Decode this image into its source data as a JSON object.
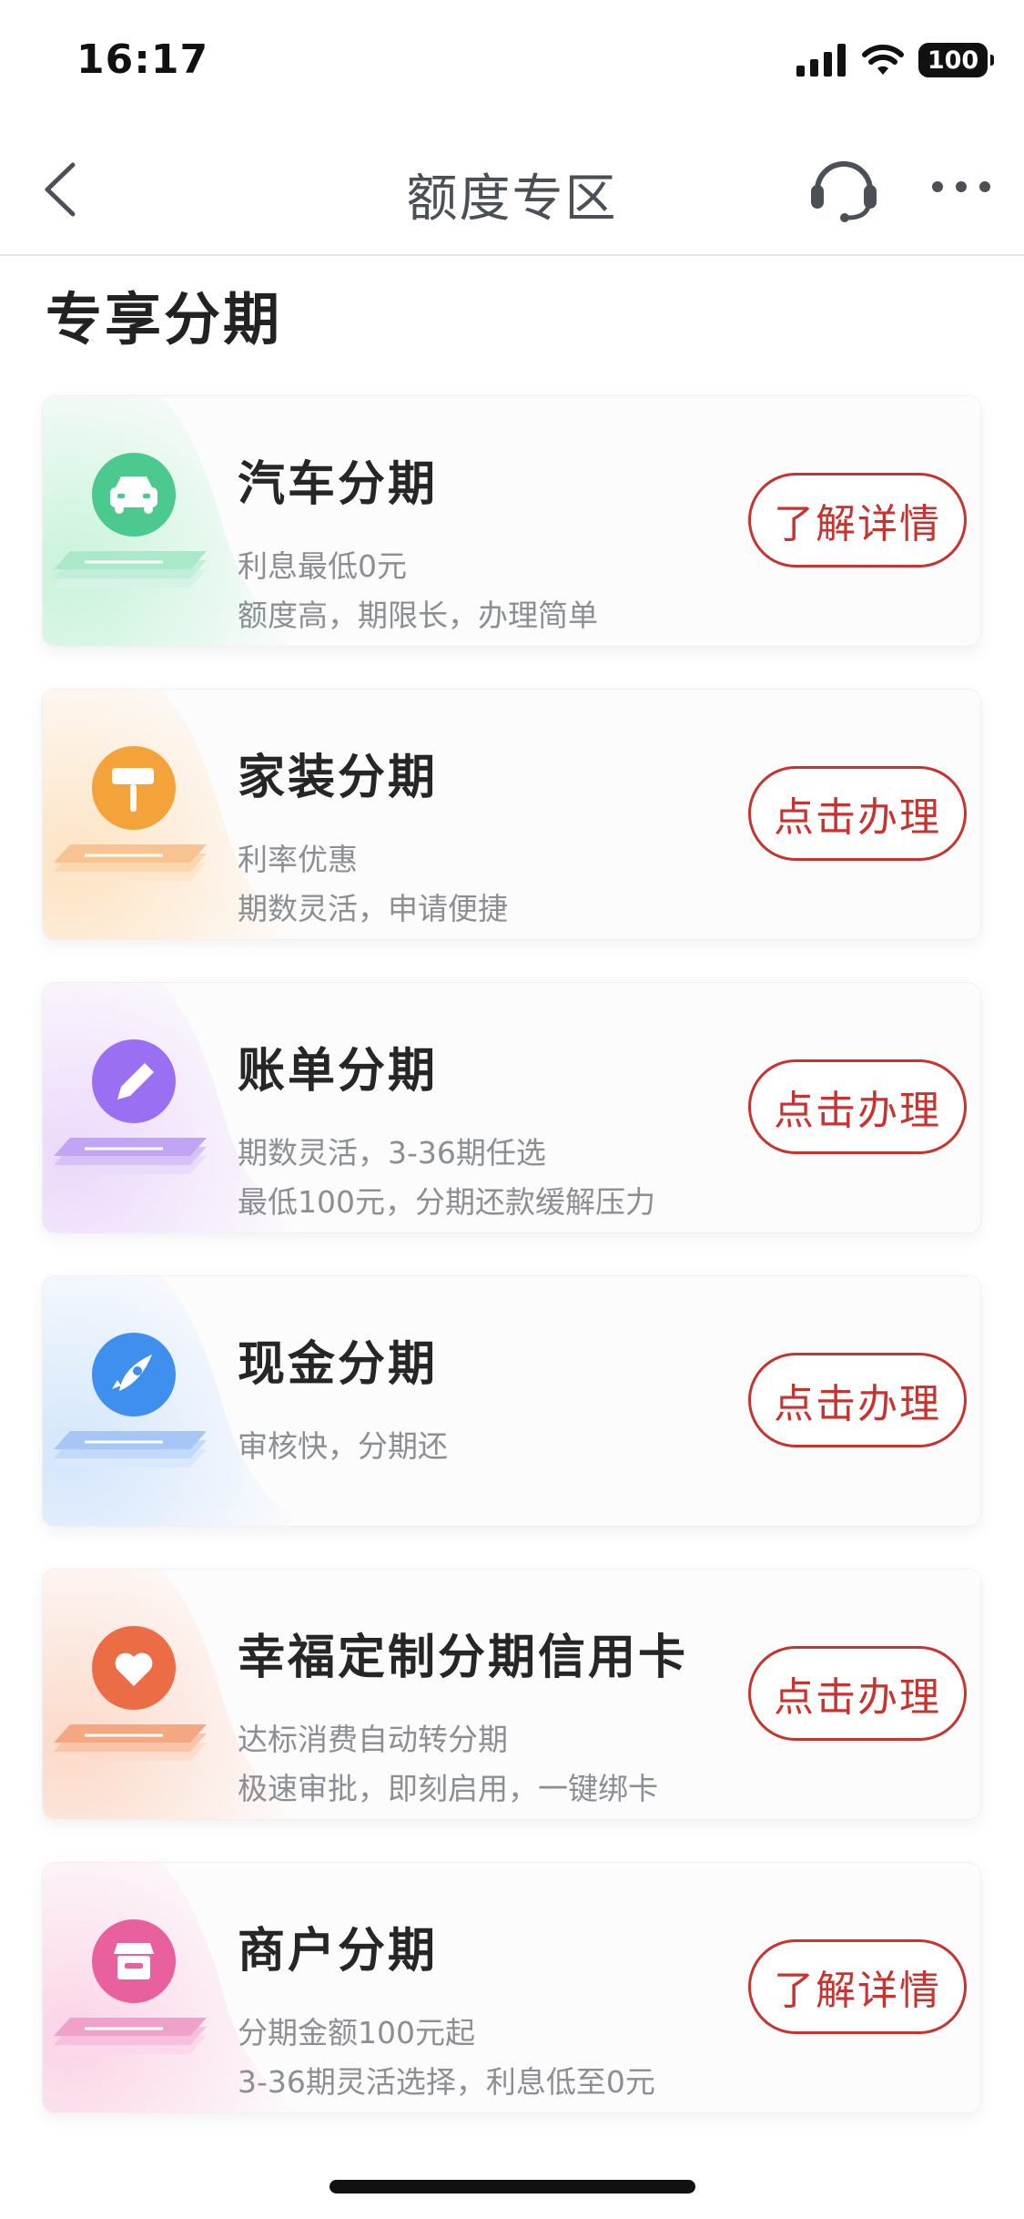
{
  "status_bar": {
    "time": "16:17",
    "battery": "100"
  },
  "nav": {
    "title": "额度专区",
    "back_icon": "chevron-left-icon",
    "service_icon": "headset-icon",
    "more_icon": "more-dots-icon"
  },
  "section_title": "专享分期",
  "cards": [
    {
      "title": "汽车分期",
      "line1": "利息最低0元",
      "line2": "额度高，期限长，办理简单",
      "button": "了解详情",
      "icon": "car-icon",
      "color": "#4cc98f"
    },
    {
      "title": "家装分期",
      "line1": "利率优惠",
      "line2": "期数灵活，申请便捷",
      "button": "点击办理",
      "icon": "paint-roller-icon",
      "color": "#f4a23a"
    },
    {
      "title": "账单分期",
      "line1": "期数灵活，3-36期任选",
      "line2": "最低100元，分期还款缓解压力",
      "button": "点击办理",
      "icon": "pencil-icon",
      "color": "#9b6ff2"
    },
    {
      "title": "现金分期",
      "line1": "审核快，分期还",
      "line2": "",
      "button": "点击办理",
      "icon": "rocket-icon",
      "color": "#3f8fef"
    },
    {
      "title": "幸福定制分期信用卡",
      "line1": "达标消费自动转分期",
      "line2": "极速审批，即刻启用，一键绑卡",
      "button": "点击办理",
      "icon": "heart-icon",
      "color": "#ec6d45"
    },
    {
      "title": "商户分期",
      "line1": "分期金额100元起",
      "line2": "3-36期灵活选择，利息低至0元",
      "button": "了解详情",
      "icon": "store-icon",
      "color": "#e9609f"
    }
  ]
}
